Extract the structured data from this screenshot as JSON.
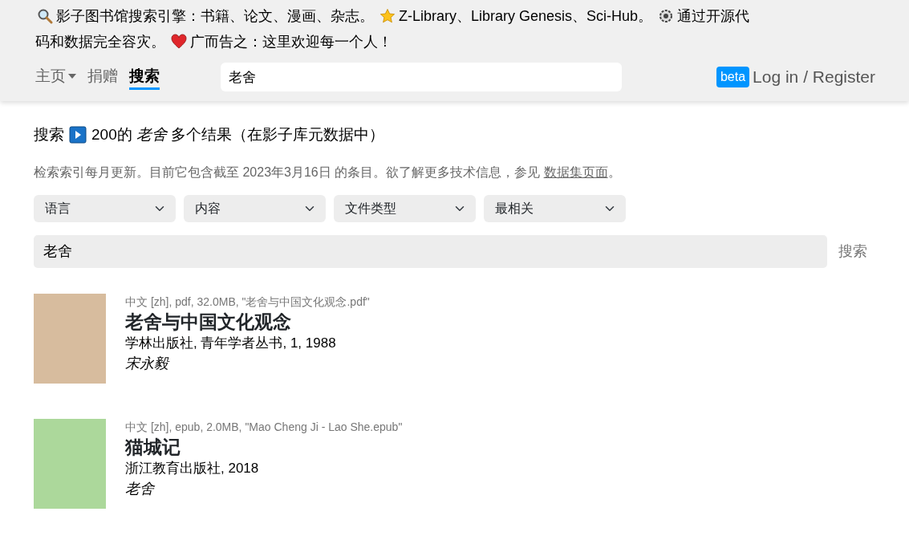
{
  "banner": [
    {
      "kind": "search",
      "text": "影子图书馆搜索引擎：书籍、论文、漫画、杂志。"
    },
    {
      "kind": "star",
      "text": "Z-Library、Library Genesis、Sci-Hub。"
    },
    {
      "kind": "gear",
      "lines": [
        "通过开源代",
        "码和数据完全容灾。"
      ]
    },
    {
      "kind": "heart",
      "text": "广而告之：这里欢迎每一个人！"
    }
  ],
  "nav": {
    "tabs": [
      {
        "label": "主页",
        "kind": "dropdown",
        "selected": false
      },
      {
        "label": "捐赠",
        "kind": "link",
        "selected": false
      },
      {
        "label": "搜索",
        "kind": "link",
        "selected": true
      }
    ],
    "search": {
      "value": "老舍"
    },
    "badge": "beta",
    "login": "Log in / Register"
  },
  "results_header": {
    "label": "搜索",
    "summary": "200的 *老舍* 多个结果（在影子库元数据中）"
  },
  "info": {
    "text": "检索索引每月更新。目前它包含截至 2023年3月16日 的条目。欲了解更多技术信息，参见 ",
    "link": "数据集页面",
    "after": "。"
  },
  "filters": [
    "语言",
    "内容",
    "文件类型",
    "最相关"
  ],
  "search_form": {
    "value": "老舍",
    "button": "搜索"
  },
  "results": [
    {
      "color": "#d7bc9e",
      "meta": "中文 [zh], pdf, 32.0MB, \"老舍与中国文化观念.pdf\"",
      "title": "老舍与中国文化观念",
      "publisher": "学林出版社, 青年学者丛书, 1, 1988",
      "author": "宋永毅"
    },
    {
      "color": "#acd89b",
      "meta": "中文 [zh], epub, 2.0MB, \"Mao Cheng Ji - Lao She.epub\"",
      "title": "猫城记",
      "publisher": "浙江教育出版社, 2018",
      "author": "老舍"
    }
  ]
}
